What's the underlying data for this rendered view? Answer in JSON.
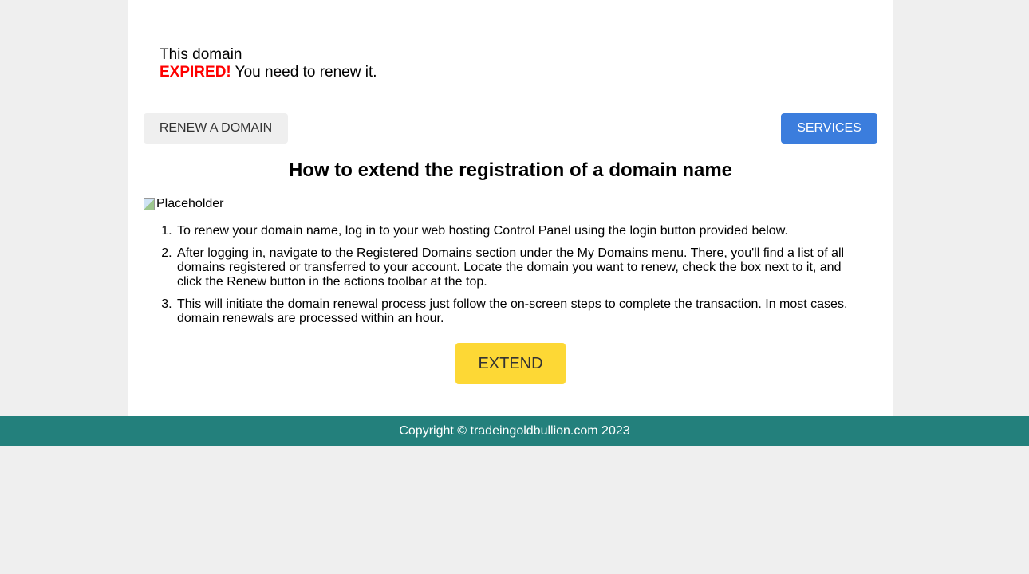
{
  "notice": {
    "line1": "This domain",
    "expired_word": "EXPIRED!",
    "line2_rest": " You need to renew it."
  },
  "buttons": {
    "renew_label": "RENEW A DOMAIN",
    "services_label": "SERVICES",
    "extend_label": "EXTEND"
  },
  "main": {
    "heading": "How to extend the registration of a domain name",
    "image_alt": "Placeholder",
    "steps": [
      "To renew your domain name, log in to your web hosting Control Panel using the login button provided below.",
      "After logging in, navigate to the Registered Domains section under the My Domains menu. There, you'll find a list of all domains registered or transferred to your account. Locate the domain you want to renew, check the box next to it, and click the Renew button in the actions toolbar at the top.",
      "This will initiate the domain renewal process just follow the on-screen steps to complete the transaction. In most cases, domain renewals are processed within an hour."
    ]
  },
  "footer": {
    "copyright": "Copyright © tradeingoldbullion.com 2023"
  },
  "colors": {
    "page_bg": "#efefef",
    "expired": "#ff0000",
    "services_button": "#3b7ddd",
    "extend_button": "#fdd835",
    "footer_bg": "#23807c"
  }
}
